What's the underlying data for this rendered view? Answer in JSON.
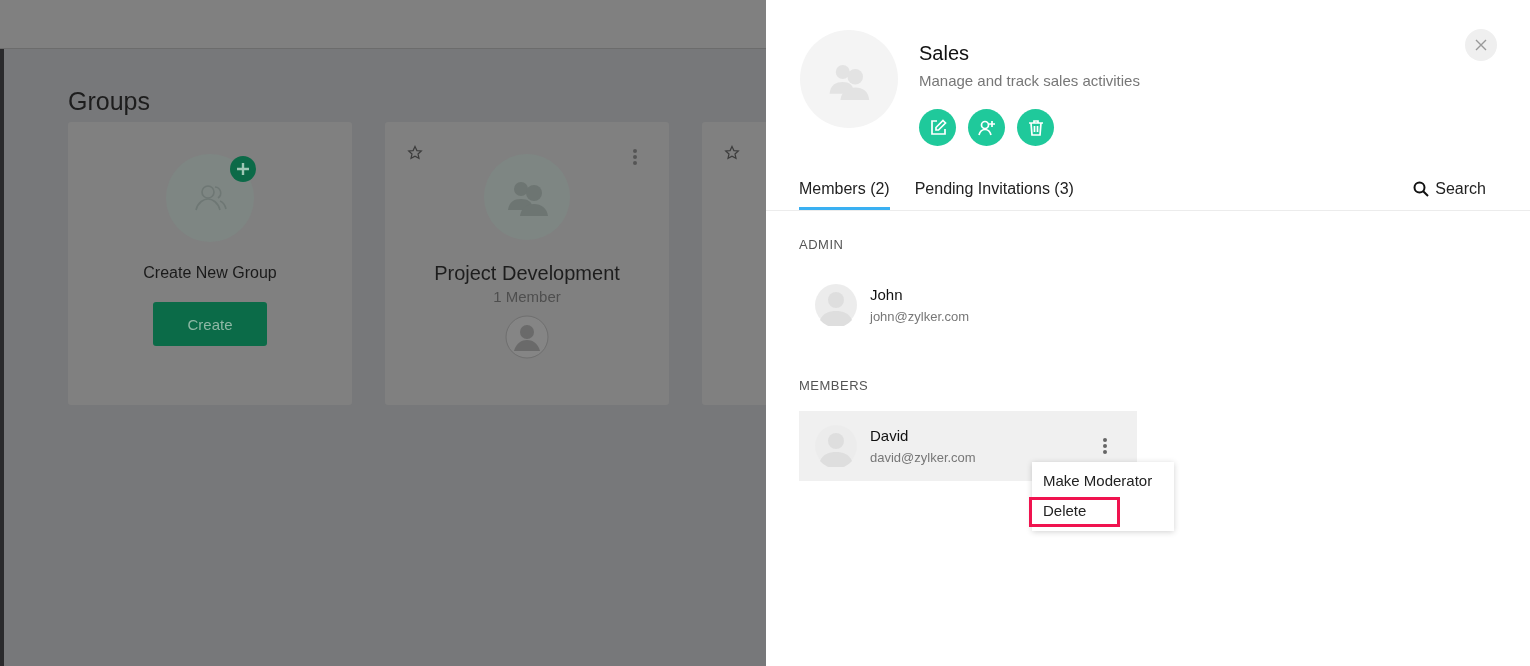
{
  "background": {
    "heading": "Groups",
    "cards": [
      {
        "kind": "create",
        "title": "Create New Group",
        "button": "Create"
      },
      {
        "kind": "group",
        "title": "Project Development",
        "subtitle": "1 Member"
      },
      {
        "kind": "group"
      }
    ]
  },
  "panel": {
    "name": "Sales",
    "description": "Manage and track sales activities",
    "tabs": [
      {
        "label": "Members (2)",
        "selected": true
      },
      {
        "label": "Pending Invitations (3)",
        "selected": false
      }
    ],
    "search": "Search",
    "sections": [
      {
        "heading": "ADMIN",
        "members": [
          {
            "name": "John",
            "email": "john@zylker.com",
            "highlighted": false
          }
        ]
      },
      {
        "heading": "MEMBERS",
        "members": [
          {
            "name": "David",
            "email": "david@zylker.com",
            "highlighted": true,
            "menu": [
              {
                "label": "Make Moderator",
                "marked": false
              },
              {
                "label": "Delete",
                "marked": true
              }
            ]
          }
        ]
      }
    ]
  }
}
